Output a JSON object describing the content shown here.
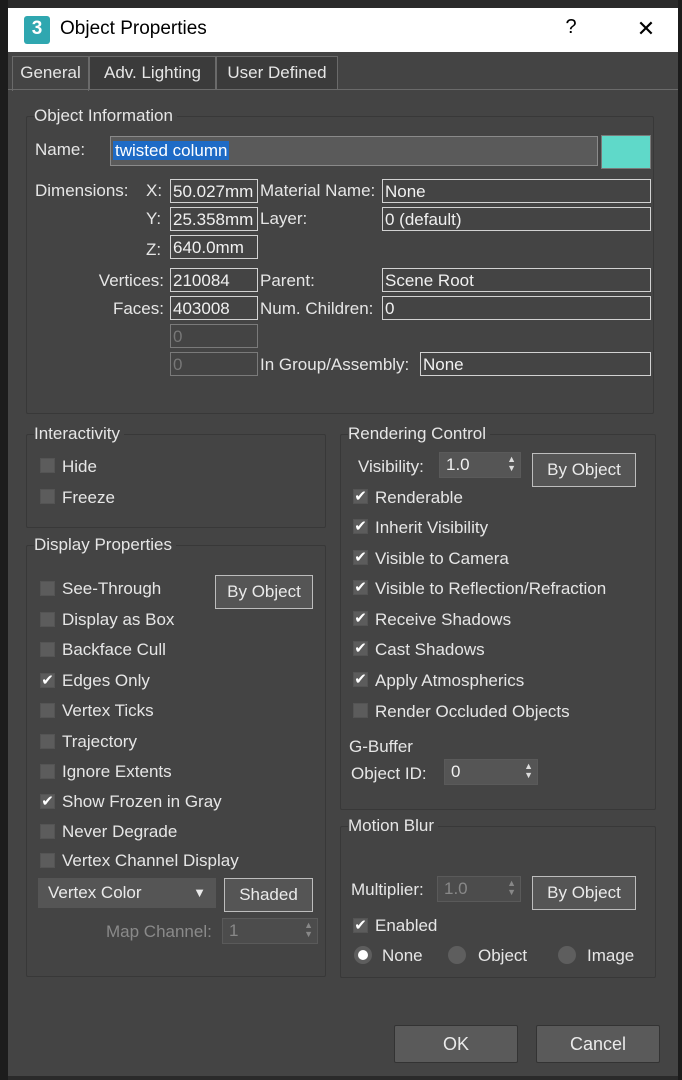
{
  "window": {
    "title": "Object Properties",
    "help": "?",
    "close": "✕",
    "app_icon_text": "3"
  },
  "tabs": [
    "General",
    "Adv. Lighting",
    "User Defined"
  ],
  "object_info": {
    "title": "Object Information",
    "name_label": "Name:",
    "name_value": "twisted column",
    "color": "#5fd9c9",
    "dimensions_label": "Dimensions:",
    "x_label": "X:",
    "x_value": "50.027mm",
    "y_label": "Y:",
    "y_value": "25.358mm",
    "z_label": "Z:",
    "z_value": "640.0mm",
    "material_label": "Material Name:",
    "material_value": "None",
    "layer_label": "Layer:",
    "layer_value": "0 (default)",
    "vertices_label": "Vertices:",
    "vertices_value": "210084",
    "faces_label": "Faces:",
    "faces_value": "403008",
    "extra1_value": "0",
    "extra2_value": "0",
    "parent_label": "Parent:",
    "parent_value": "Scene Root",
    "children_label": "Num. Children:",
    "children_value": "0",
    "group_label": "In Group/Assembly:",
    "group_value": "None"
  },
  "interactivity": {
    "title": "Interactivity",
    "items": [
      {
        "label": "Hide",
        "checked": false
      },
      {
        "label": "Freeze",
        "checked": false
      }
    ]
  },
  "display_properties": {
    "title": "Display Properties",
    "by_object": "By Object",
    "items": [
      {
        "label": "See-Through",
        "checked": false
      },
      {
        "label": "Display as Box",
        "checked": false
      },
      {
        "label": "Backface Cull",
        "checked": false
      },
      {
        "label": "Edges Only",
        "checked": true
      },
      {
        "label": "Vertex Ticks",
        "checked": false
      },
      {
        "label": "Trajectory",
        "checked": false
      },
      {
        "label": "Ignore Extents",
        "checked": false
      },
      {
        "label": "Show Frozen in Gray",
        "checked": true
      },
      {
        "label": "Never Degrade",
        "checked": false
      },
      {
        "label": "Vertex Channel Display",
        "checked": false
      }
    ],
    "vertex_color": "Vertex Color",
    "shaded": "Shaded",
    "map_channel_label": "Map Channel:",
    "map_channel_value": "1"
  },
  "rendering_control": {
    "title": "Rendering Control",
    "visibility_label": "Visibility:",
    "visibility_value": "1.0",
    "by_object": "By Object",
    "items": [
      {
        "label": "Renderable",
        "checked": true
      },
      {
        "label": "Inherit Visibility",
        "checked": true
      },
      {
        "label": "Visible to Camera",
        "checked": true
      },
      {
        "label": "Visible to Reflection/Refraction",
        "checked": true
      },
      {
        "label": "Receive Shadows",
        "checked": true
      },
      {
        "label": "Cast Shadows",
        "checked": true
      },
      {
        "label": "Apply Atmospherics",
        "checked": true
      },
      {
        "label": "Render Occluded Objects",
        "checked": false
      }
    ],
    "gbuffer_title": "G-Buffer",
    "object_id_label": "Object ID:",
    "object_id_value": "0"
  },
  "motion_blur": {
    "title": "Motion Blur",
    "multiplier_label": "Multiplier:",
    "multiplier_value": "1.0",
    "by_object": "By Object",
    "enabled_label": "Enabled",
    "enabled_checked": true,
    "options": [
      {
        "label": "None",
        "selected": true
      },
      {
        "label": "Object",
        "selected": false
      },
      {
        "label": "Image",
        "selected": false
      }
    ]
  },
  "footer": {
    "ok": "OK",
    "cancel": "Cancel"
  }
}
